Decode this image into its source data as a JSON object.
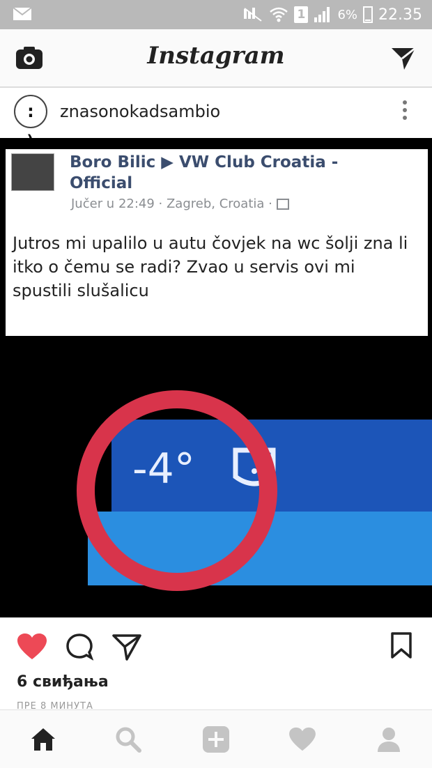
{
  "status_bar": {
    "icons": [
      "mail-icon",
      "mute-icon",
      "wifi-icon",
      "signal-icon",
      "battery-icon"
    ],
    "sim_slot": "1",
    "battery_percent": "6%",
    "time": "22.35"
  },
  "top_bar": {
    "logo": "Instagram",
    "left_icon": "camera-icon",
    "right_icon": "direct-message-icon"
  },
  "post_header": {
    "avatar_text": ": )",
    "username": "znasonokadsambio",
    "menu_icon": "more-vertical-icon"
  },
  "embedded_post": {
    "author_line1": "Boro Bilic ▶ VW Club Croatia -",
    "author_line2": "Official",
    "meta": "Jučer u 22:49 · Zagreb, Croatia · ",
    "text": "Jutros mi upalilo u autu čovjek na wc šolji zna li itko o čemu se radi?  Zvao u servis ovi mi spustili slušalicu",
    "dashboard_reading": "-4°",
    "colors": {
      "ring": "#d8344b",
      "band_dark": "#1c55b8",
      "band_light": "#2b8ee0"
    }
  },
  "actions": {
    "like_icon": "heart-filled-icon",
    "comment_icon": "comment-icon",
    "share_icon": "share-icon",
    "save_icon": "bookmark-icon",
    "like_color": "#ed4956"
  },
  "likes_text": "6 свиђања",
  "timestamp": "ПРЕ 8 МИНУТА",
  "bottom_nav": {
    "items": [
      "home-icon",
      "search-icon",
      "add-post-icon",
      "activity-heart-icon",
      "profile-icon"
    ]
  }
}
